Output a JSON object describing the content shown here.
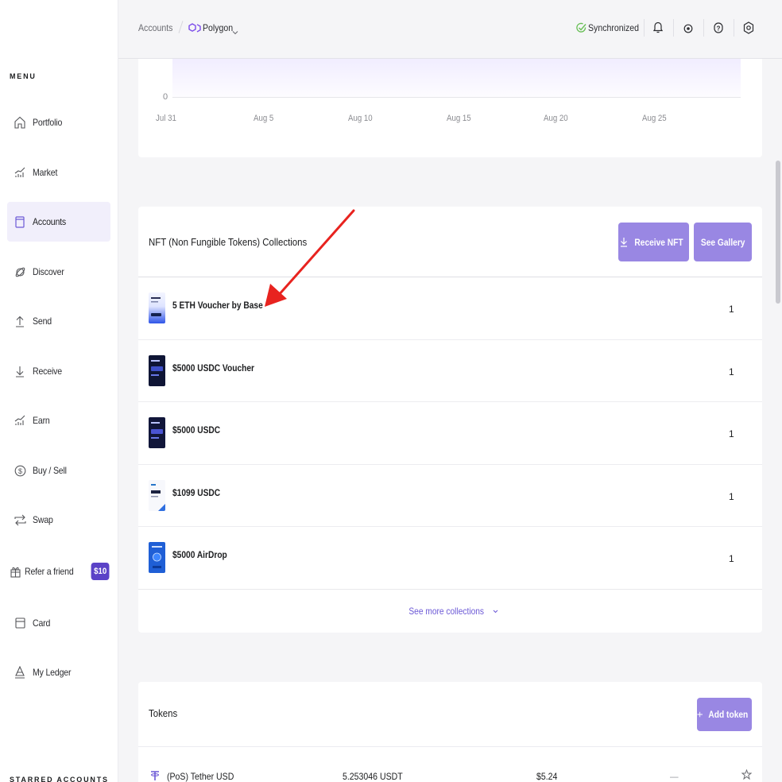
{
  "sidebar": {
    "menu_title": "MENU",
    "items": [
      {
        "label": "Portfolio",
        "icon": "home-icon"
      },
      {
        "label": "Market",
        "icon": "chart-icon"
      },
      {
        "label": "Accounts",
        "icon": "wallet-icon",
        "active": true
      },
      {
        "label": "Discover",
        "icon": "planet-icon"
      },
      {
        "label": "Send",
        "icon": "arrow-up-icon"
      },
      {
        "label": "Receive",
        "icon": "arrow-down-icon"
      },
      {
        "label": "Earn",
        "icon": "earn-chart-icon"
      },
      {
        "label": "Buy / Sell",
        "icon": "dollar-icon"
      },
      {
        "label": "Swap",
        "icon": "swap-icon"
      },
      {
        "label": "Refer a friend",
        "icon": "gift-icon",
        "badge": "$10"
      },
      {
        "label": "Card",
        "icon": "card-icon"
      },
      {
        "label": "My Ledger",
        "icon": "ledger-icon"
      }
    ],
    "starred_title": "STARRED ACCOUNTS"
  },
  "topbar": {
    "breadcrumb_accounts": "Accounts",
    "breadcrumb_network": "Polygon",
    "sync_status": "Synchronized",
    "icons": [
      "bell-icon",
      "eye-icon",
      "help-icon",
      "settings-icon"
    ]
  },
  "chart": {
    "y_zero": "0",
    "x_ticks": [
      "Jul 31",
      "Aug 5",
      "Aug 10",
      "Aug 15",
      "Aug 20",
      "Aug 25"
    ]
  },
  "nft": {
    "title": "NFT (Non Fungible Tokens) Collections",
    "receive_label": "Receive NFT",
    "gallery_label": "See Gallery",
    "collections": [
      {
        "name": "5 ETH Voucher by Base",
        "count": "1",
        "thumb": "light-blue"
      },
      {
        "name": "$5000 USDC Voucher",
        "count": "1",
        "thumb": "dark-navy"
      },
      {
        "name": "$5000 USDC",
        "count": "1",
        "thumb": "dark-navy"
      },
      {
        "name": "$1099 USDC",
        "count": "1",
        "thumb": "white"
      },
      {
        "name": "$5000 AirDrop",
        "count": "1",
        "thumb": "blue"
      }
    ],
    "see_more": "See more collections"
  },
  "tokens": {
    "title": "Tokens",
    "add_label": "Add token",
    "rows": [
      {
        "name": "(PoS) Tether USD",
        "amount": "5.253046 USDT",
        "value": "$5.24",
        "change": "—"
      }
    ]
  },
  "colors": {
    "accent": "#9987e3",
    "accent_dark": "#5b43c7",
    "link": "#6c59d6",
    "sync_green": "#66be54",
    "annotation_red": "#e8231f"
  }
}
